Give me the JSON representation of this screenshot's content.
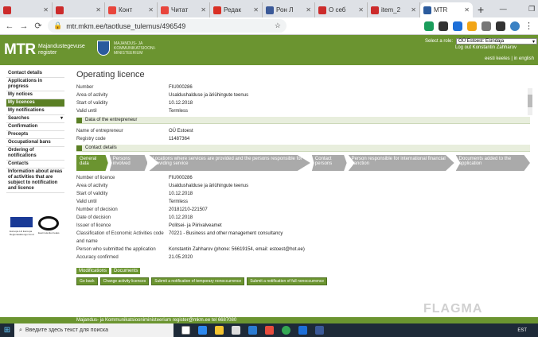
{
  "browser": {
    "tabs": [
      {
        "title": "",
        "color": "#cc2b2b"
      },
      {
        "title": "",
        "color": "#cc2b2b"
      },
      {
        "title": "Конт",
        "color": "#e8453c"
      },
      {
        "title": "Читат",
        "color": "#e8453c"
      },
      {
        "title": "Редак",
        "color": "#d93025"
      },
      {
        "title": "Рон Л",
        "color": "#3b5998"
      },
      {
        "title": "О себ",
        "color": "#cc2b2b"
      },
      {
        "title": "item_2",
        "color": "#cc2b2b"
      },
      {
        "title": "MTR",
        "color": "#2b5b9d",
        "active": true
      }
    ],
    "new_tab": "+",
    "url": "mtr.mkm.ee/taotluse_tulemus/496549",
    "window_controls": [
      "—",
      "❐",
      "✕"
    ]
  },
  "header": {
    "logo": "MTR",
    "logo_sub_1": "Majandustegevuse",
    "logo_sub_2": "register",
    "ministry_1": "MAJANDUS- JA",
    "ministry_2": "KOMMUNIKATSIOONI-",
    "ministry_3": "MINISTEERIUM",
    "role_label": "Select a role:",
    "role_value": "OÜ Estoest: Esindaja",
    "logout": "Log out Konstantin Zahharov",
    "lang_et": "eesti keeles",
    "lang_sep": "|",
    "lang_en": "in english"
  },
  "sidebar": {
    "items": [
      {
        "label": "Contact details"
      },
      {
        "label": "Applications in progress"
      },
      {
        "label": "My notices"
      },
      {
        "label": "My licences",
        "active": true
      },
      {
        "label": "My notifications"
      },
      {
        "label": "Searches",
        "expand": "▾"
      },
      {
        "label": "Confirmation"
      },
      {
        "label": "Precepts"
      },
      {
        "label": "Occupational bans"
      },
      {
        "label": "Ordering of notifications"
      },
      {
        "label": "Contacts"
      },
      {
        "label": "Information about areas of activities that are subject to notification and licence"
      }
    ],
    "eu_caption": "Euroopa Liit Euroopa Regionaalarengu Fond",
    "ee_caption": "Eesti tuleviku heaks"
  },
  "main": {
    "title": "Operating licence",
    "summary": [
      {
        "k": "Number",
        "v": "FIU000286"
      },
      {
        "k": "Area of activity",
        "v": "Usaldushalduse ja äriühingute teenus"
      },
      {
        "k": "Start of validity",
        "v": "10.12.2018"
      },
      {
        "k": "Valid until",
        "v": "Termless"
      }
    ],
    "entrepreneur_section": "Data of the entrepreneur",
    "entrepreneur": [
      {
        "k": "Name of entrepreneur",
        "v": "OÜ Estoest"
      },
      {
        "k": "Registry code",
        "v": "11487364"
      }
    ],
    "contact_section": "Contact details",
    "tabs": [
      {
        "label": "General data",
        "active": true
      },
      {
        "label": "Persons involved"
      },
      {
        "label": "Locations where services are provided and the persons responsible for providing service"
      },
      {
        "label": "Contact persons"
      },
      {
        "label": "Person responsible for international financial sanction"
      },
      {
        "label": "Documents added to the application"
      }
    ],
    "details": [
      {
        "k": "Number of licence",
        "v": "FIU000286"
      },
      {
        "k": "Area of activity",
        "v": "Usaldushalduse ja äriühingute teenus"
      },
      {
        "k": "Start of validity",
        "v": "10.12.2018"
      },
      {
        "k": "Valid until",
        "v": "Termless"
      },
      {
        "k": "Number of decision",
        "v": "20181210-221507"
      },
      {
        "k": "Date of decision",
        "v": "10.12.2018"
      },
      {
        "k": "Issuer of licence",
        "v": "Politsei- ja Piirivalveamet"
      },
      {
        "k": "Classification of Economic Activities code and name",
        "v": "70221 - Business and other management consultancy"
      },
      {
        "k": "Person who submitted the application",
        "v": "Konstantin Zahharov (phone: 56619154, email: estoest@hot.ee)"
      },
      {
        "k": "Accuracy confirmed",
        "v": "21.05.2020"
      }
    ],
    "doc_tabs": [
      "Modifications",
      "Documents"
    ],
    "actions": [
      "Go back",
      "Change activity licences",
      "Submit a notification of temporary nonoccurrence",
      "Submit a notification of full nonoccurrence"
    ]
  },
  "footer": {
    "text": "Majandus- ja Kommunikatsiooniministeerium register@mkm.ee tel 6687080"
  },
  "taskbar": {
    "search_placeholder": "Введите здесь текст для поиска",
    "tray": "EST"
  },
  "watermark": "FLAGMA"
}
